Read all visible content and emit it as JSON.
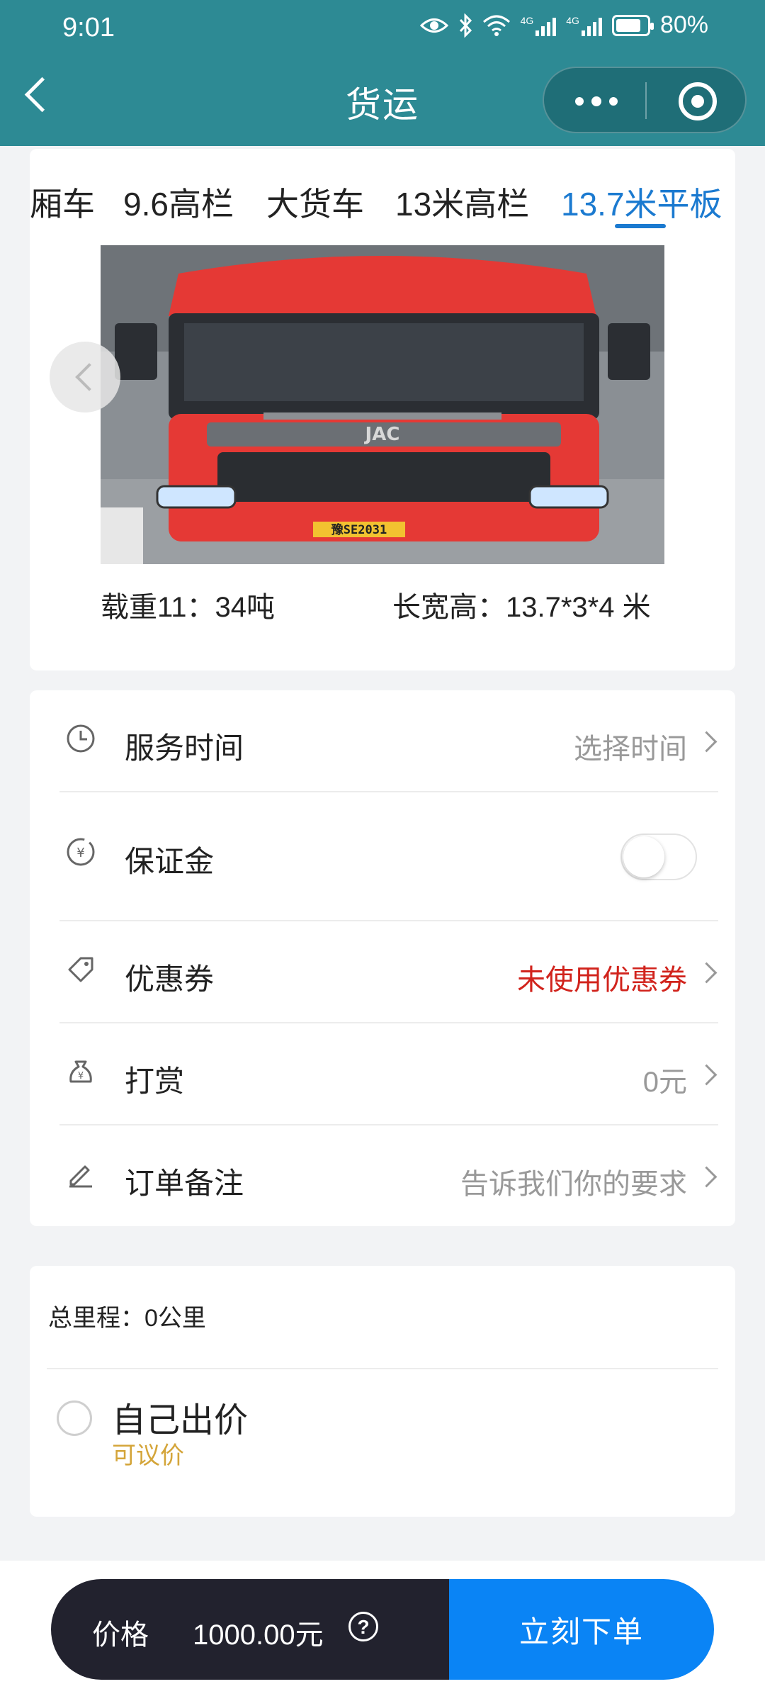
{
  "status_bar": {
    "time": "9:01",
    "battery_percent": "80%",
    "battery_level": 0.8,
    "network_1": "4G",
    "network_2": "4G"
  },
  "nav": {
    "title": "货运"
  },
  "vehicle_tabs": {
    "items": [
      "厢车",
      "9.6高栏",
      "大货车",
      "13米高栏",
      "13.7米平板"
    ],
    "active_index": 4
  },
  "vehicle": {
    "image_plate_text": "豫SE2031",
    "image_brand_text": "JAC",
    "load": "载重11：34吨",
    "dimensions": "长宽高：13.7*3*4 米"
  },
  "options": {
    "service_time": {
      "label": "服务时间",
      "value": "选择时间",
      "icon": "clock-icon"
    },
    "deposit": {
      "label": "保证金",
      "enabled": false,
      "icon": "yen-coin-icon"
    },
    "coupon": {
      "label": "优惠券",
      "value": "未使用优惠券",
      "value_color": "#d1231c",
      "icon": "tag-icon"
    },
    "tip": {
      "label": "打赏",
      "value": "0元",
      "icon": "money-bag-icon"
    },
    "remark": {
      "label": "订单备注",
      "value": "告诉我们你的要求",
      "icon": "pencil-icon"
    }
  },
  "pricing": {
    "mileage": "总里程：0公里",
    "self_price_label": "自己出价",
    "negotiable_label": "可议价",
    "selected": false
  },
  "order_bar": {
    "price_label": "价格",
    "price_value": "1000.00元",
    "help_icon": "?",
    "submit_label": "立刻下单",
    "accent": "#0a84f5",
    "dark": "#22222e"
  },
  "colors": {
    "header": "#2d8a94",
    "active_tab": "#1b7ad0"
  }
}
